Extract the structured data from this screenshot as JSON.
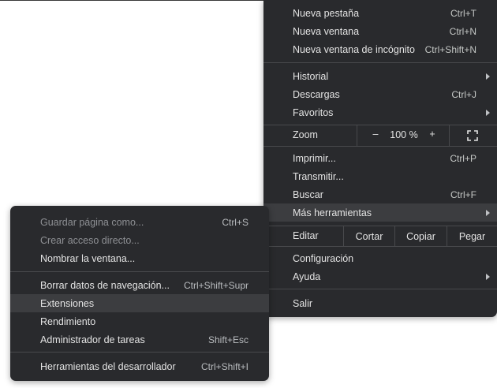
{
  "main_menu": {
    "group1": [
      {
        "label": "Nueva pestaña",
        "shortcut": "Ctrl+T"
      },
      {
        "label": "Nueva ventana",
        "shortcut": "Ctrl+N"
      },
      {
        "label": "Nueva ventana de incógnito",
        "shortcut": "Ctrl+Shift+N"
      }
    ],
    "group2": [
      {
        "label": "Historial",
        "shortcut": ""
      },
      {
        "label": "Descargas",
        "shortcut": "Ctrl+J"
      },
      {
        "label": "Favoritos",
        "shortcut": ""
      }
    ],
    "zoom": {
      "label": "Zoom",
      "minus": "–",
      "value": "100 %",
      "plus": "+"
    },
    "group3": [
      {
        "label": "Imprimir...",
        "shortcut": "Ctrl+P"
      },
      {
        "label": "Transmitir...",
        "shortcut": ""
      },
      {
        "label": "Buscar",
        "shortcut": "Ctrl+F"
      },
      {
        "label": "Más herramientas",
        "shortcut": ""
      }
    ],
    "edit": {
      "label": "Editar",
      "cut": "Cortar",
      "copy": "Copiar",
      "paste": "Pegar"
    },
    "group4": [
      {
        "label": "Configuración",
        "shortcut": ""
      },
      {
        "label": "Ayuda",
        "shortcut": ""
      }
    ],
    "exit": {
      "label": "Salir"
    }
  },
  "sub_menu": {
    "group1": [
      {
        "label": "Guardar página como...",
        "shortcut": "Ctrl+S"
      },
      {
        "label": "Crear acceso directo...",
        "shortcut": ""
      },
      {
        "label": "Nombrar la ventana...",
        "shortcut": ""
      }
    ],
    "group2": [
      {
        "label": "Borrar datos de navegación...",
        "shortcut": "Ctrl+Shift+Supr"
      },
      {
        "label": "Extensiones",
        "shortcut": ""
      },
      {
        "label": "Rendimiento",
        "shortcut": ""
      },
      {
        "label": "Administrador de tareas",
        "shortcut": "Shift+Esc"
      }
    ],
    "group3": [
      {
        "label": "Herramientas del desarrollador",
        "shortcut": "Ctrl+Shift+I"
      }
    ]
  },
  "colors": {
    "menu_bg": "#292a2d",
    "hover_bg": "#3c3d40",
    "text": "#e3e3e3",
    "disabled_text": "#8e9094"
  }
}
